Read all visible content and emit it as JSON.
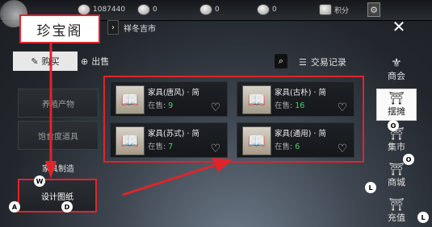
{
  "topbar": {
    "items": [
      {
        "icon": "coin-icon",
        "value": "1087440"
      },
      {
        "icon": "shell-icon",
        "value": "0"
      },
      {
        "icon": "feather-icon",
        "value": "0"
      },
      {
        "icon": "scroll-icon",
        "value": "0"
      }
    ],
    "points_label": "积分"
  },
  "title": "珍宝阁",
  "breadcrumb": "祥冬吉市",
  "tabs": {
    "buy": "购买",
    "sell": "出售"
  },
  "records_label": "交易记录",
  "categories": [
    {
      "label": "养殖产物"
    },
    {
      "label": "饱食度道具"
    },
    {
      "label": "家具制造"
    },
    {
      "label": "设计图纸",
      "badge_left": "A",
      "badge_top": "W",
      "badge_bottom": "D"
    }
  ],
  "items": [
    {
      "name": "家具(唐风) · 简",
      "status_label": "在售:",
      "count": "9"
    },
    {
      "name": "家具(古朴) · 简",
      "status_label": "在售:",
      "count": "16"
    },
    {
      "name": "家具(苏式) · 简",
      "status_label": "在售:",
      "count": "7"
    },
    {
      "name": "家具(通用) · 简",
      "status_label": "在售:",
      "count": "6"
    }
  ],
  "sidebar": [
    {
      "label": "商会",
      "icon": "guild-icon"
    },
    {
      "label": "摆摊",
      "icon": "stall-icon"
    },
    {
      "label": "集市",
      "icon": "market-icon"
    },
    {
      "label": "商城",
      "icon": "shop-icon"
    },
    {
      "label": "充值",
      "icon": "recharge-icon"
    }
  ],
  "side_badges": [
    "O",
    "O",
    "L",
    "L"
  ],
  "colors": {
    "highlight": "#e0242a",
    "count": "#4ecf6b"
  }
}
